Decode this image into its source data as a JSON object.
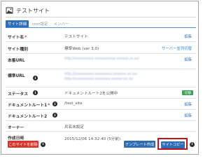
{
  "header": {
    "title": "テストサイト",
    "icon": "image-icon"
  },
  "tabs": [
    {
      "label": "サイト詳細",
      "active": true
    },
    {
      "label": "cron設定",
      "active": false
    },
    {
      "label": "メンバー",
      "active": false
    }
  ],
  "rows": {
    "site_name": {
      "label": "サイト名",
      "required": "*",
      "value": "テストサイト",
      "link": "編集"
    },
    "site_type": {
      "label": "サイト種別",
      "value": "標準Web (ver 3.0)",
      "link": "サーバー並列切替"
    },
    "prod_url": {
      "label": "本番URL",
      "value": "http://xxxxxxxxxx.xxxxxxxxxxx.xxxxxx.xx.xx/",
      "link": "編集"
    },
    "std_url": {
      "label": "標準URL",
      "value": "http://xxxxxxxxxx.xxxxxxxxx.xxxxxxx.xx.xx/\nhttp://xxxxxxxxxx.xxxxxxxx.xxxxxx.xx.xx/",
      "link": ""
    },
    "status": {
      "label": "ステータス",
      "value": "ドキュメントルート2を公開中",
      "toggle": "切替"
    },
    "docroot1": {
      "label": "ドキュメントルート1",
      "required": "*",
      "value": "/test_site",
      "link": "編集"
    },
    "docroot2": {
      "label": "ドキュメントルート2",
      "value": "",
      "link": "編集"
    },
    "owner": {
      "label": "オーナー",
      "value": "兵名未設定"
    },
    "created": {
      "label": "作成日時",
      "value": "2015/12/06 14:32:40 (5分前)"
    }
  },
  "buttons": {
    "delete": "このサイトを削除",
    "template": "テンプレート作成",
    "copy": "サイトコピー"
  },
  "colors": {
    "primary": "#2f6db5",
    "danger": "#d9342b",
    "success": "#3aa35a",
    "link": "#3a86d4",
    "highlight": "#c4141b"
  }
}
